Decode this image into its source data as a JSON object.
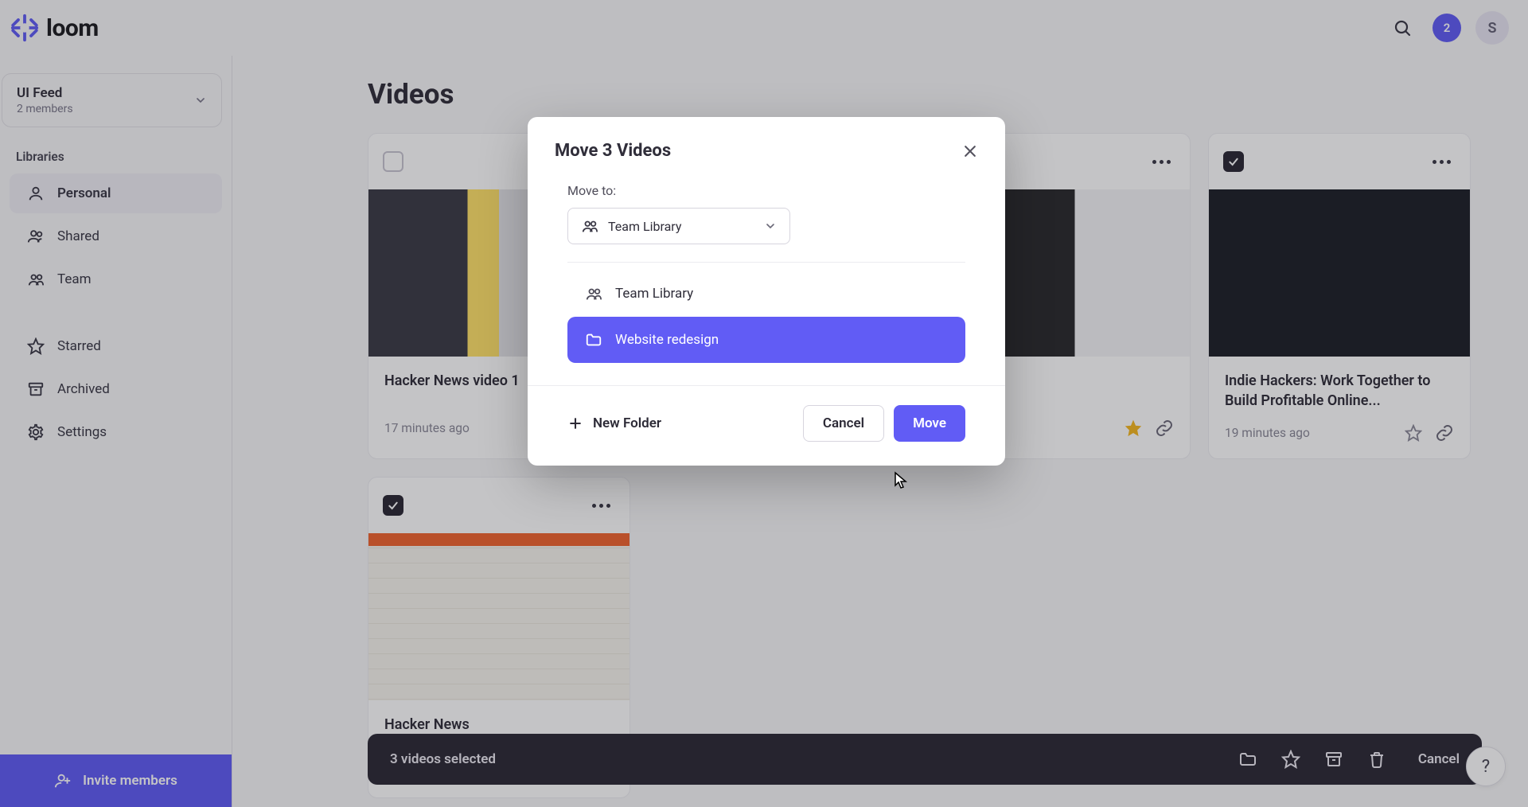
{
  "brand": "loom",
  "header": {
    "notif_count": "2",
    "avatar_initial": "S"
  },
  "sidebar": {
    "team": {
      "name": "UI Feed",
      "meta": "2 members"
    },
    "libraries_heading": "Libraries",
    "items": [
      {
        "label": "Personal",
        "icon": "user"
      },
      {
        "label": "Shared",
        "icon": "users"
      },
      {
        "label": "Team",
        "icon": "team"
      }
    ],
    "utility": [
      {
        "label": "Starred",
        "icon": "star"
      },
      {
        "label": "Archived",
        "icon": "archive"
      },
      {
        "label": "Settings",
        "icon": "gear"
      }
    ],
    "invite_label": "Invite members"
  },
  "page": {
    "title": "Videos"
  },
  "videos": [
    {
      "title": "Hacker News video 1",
      "time": "17 minutes ago",
      "checked": false,
      "starred": false
    },
    {
      "title": "",
      "time": "",
      "checked": false,
      "starred": false
    },
    {
      "title": "",
      "time": "",
      "checked": false,
      "starred": true
    },
    {
      "title": "Indie Hackers: Work Together to Build Profitable Online...",
      "time": "19 minutes ago",
      "checked": true,
      "starred": false
    },
    {
      "title": "Hacker News",
      "time": "",
      "checked": true,
      "starred": false
    }
  ],
  "selection_bar": {
    "text": "3 videos selected",
    "cancel": "Cancel"
  },
  "modal": {
    "title": "Move 3 Videos",
    "move_to_label": "Move to:",
    "dest_selected": "Team Library",
    "folders": [
      {
        "label": "Team Library",
        "icon": "team",
        "selected": false
      },
      {
        "label": "Website redesign",
        "icon": "folder",
        "selected": true
      }
    ],
    "new_folder": "New Folder",
    "cancel": "Cancel",
    "confirm": "Move"
  },
  "fab": "?"
}
